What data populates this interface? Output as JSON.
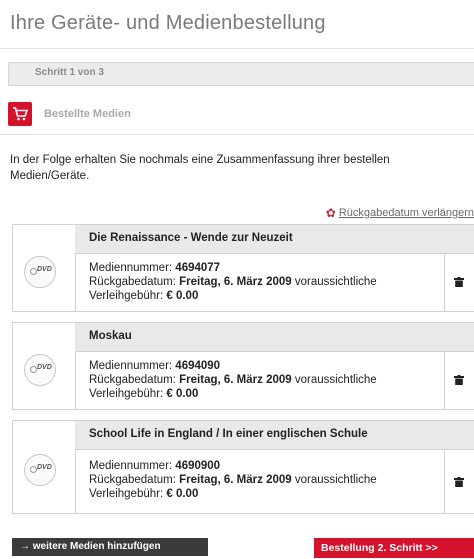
{
  "page": {
    "title": "Ihre Geräte- und Medienbestellung"
  },
  "steps": {
    "label": "Schritt 1 von 3"
  },
  "section": {
    "icon": "shopping-cart-icon",
    "label": "Bestellte Medien"
  },
  "intro": "In der Folge erhalten Sie nochmals eine Zusammenfassung ihrer bestellen Medien/Geräte.",
  "extend": {
    "icon": "gear-icon",
    "label": "Rückgabedatum verlängern"
  },
  "items": [
    {
      "title": "Die Renaissance - Wende zur Neuzeit",
      "number_label": "Mediennummer:",
      "number": "4694077",
      "return_label": "Rückgabedatum:",
      "return_date": "Freitag, 6. März 2009",
      "return_suffix": "voraussichtliche",
      "fee_label": "Verleihgebühr:",
      "fee": "€ 0.00",
      "type": "DVD"
    },
    {
      "title": "Moskau",
      "number_label": "Mediennummer:",
      "number": "4694090",
      "return_label": "Rückgabedatum:",
      "return_date": "Freitag, 6. März 2009",
      "return_suffix": "voraussichtliche",
      "fee_label": "Verleihgebühr:",
      "fee": "€ 0.00",
      "type": "DVD"
    },
    {
      "title": "School Life in England / In einer englischen Schule",
      "number_label": "Mediennummer:",
      "number": "4690900",
      "return_label": "Rückgabedatum:",
      "return_date": "Freitag, 6. März 2009",
      "return_suffix": "voraussichtliche",
      "fee_label": "Verleihgebühr:",
      "fee": "€ 0.00",
      "type": "DVD"
    }
  ],
  "buttons": {
    "more": "→ weitere Medien hinzufügen",
    "next": "Bestellung 2. Schritt >>"
  },
  "colors": {
    "accent": "#d4122b",
    "dark_button": "#3b3b3b"
  }
}
